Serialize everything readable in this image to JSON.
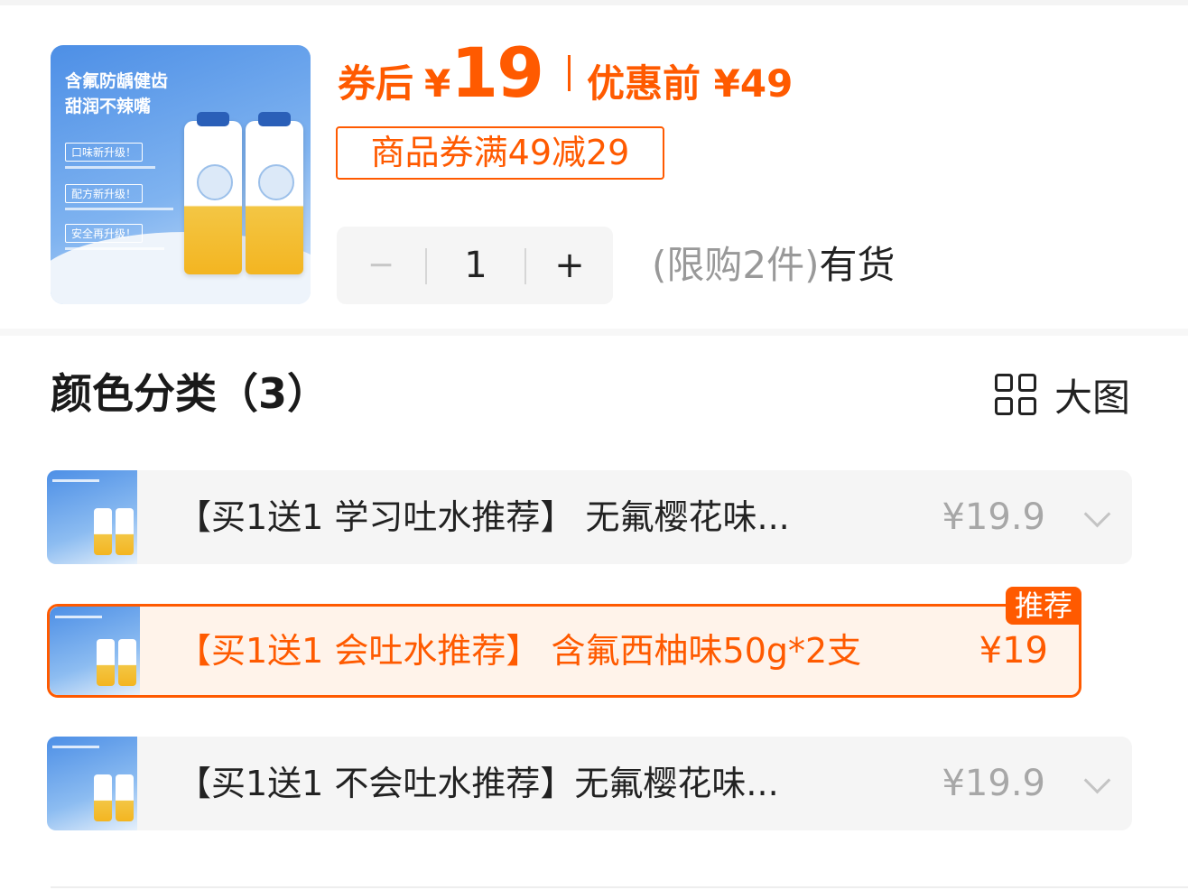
{
  "product_image": {
    "headline": "含氟防龋健齿\n甜润不辣嘴",
    "tags": [
      "口味新升级！",
      "配方新升级！",
      "安全再升级！"
    ]
  },
  "price": {
    "after_label": "券后",
    "currency": "¥",
    "after_value": "19",
    "before_label": "优惠前 ¥49"
  },
  "coupon": {
    "label": "商品券满49减29"
  },
  "stepper": {
    "minus": "−",
    "quantity": "1",
    "plus": "+"
  },
  "stock": {
    "limit": "(限购2件)",
    "status": "有货"
  },
  "section": {
    "title": "颜色分类（3）",
    "big_image_label": "大图"
  },
  "variants": [
    {
      "name": "【买1送1 学习吐水推荐】 无氟樱花味...",
      "price": "¥19.9",
      "selected": false
    },
    {
      "name": "【买1送1 会吐水推荐】 含氟西柚味50g*2支",
      "price": "¥19",
      "selected": true,
      "badge": "推荐"
    },
    {
      "name": "【买1送1 不会吐水推荐】无氟樱花味...",
      "price": "¥19.9",
      "selected": false
    }
  ],
  "colors": {
    "accent": "#ff5a00",
    "muted": "#a7a7a7",
    "card_bg": "#f5f5f5"
  }
}
